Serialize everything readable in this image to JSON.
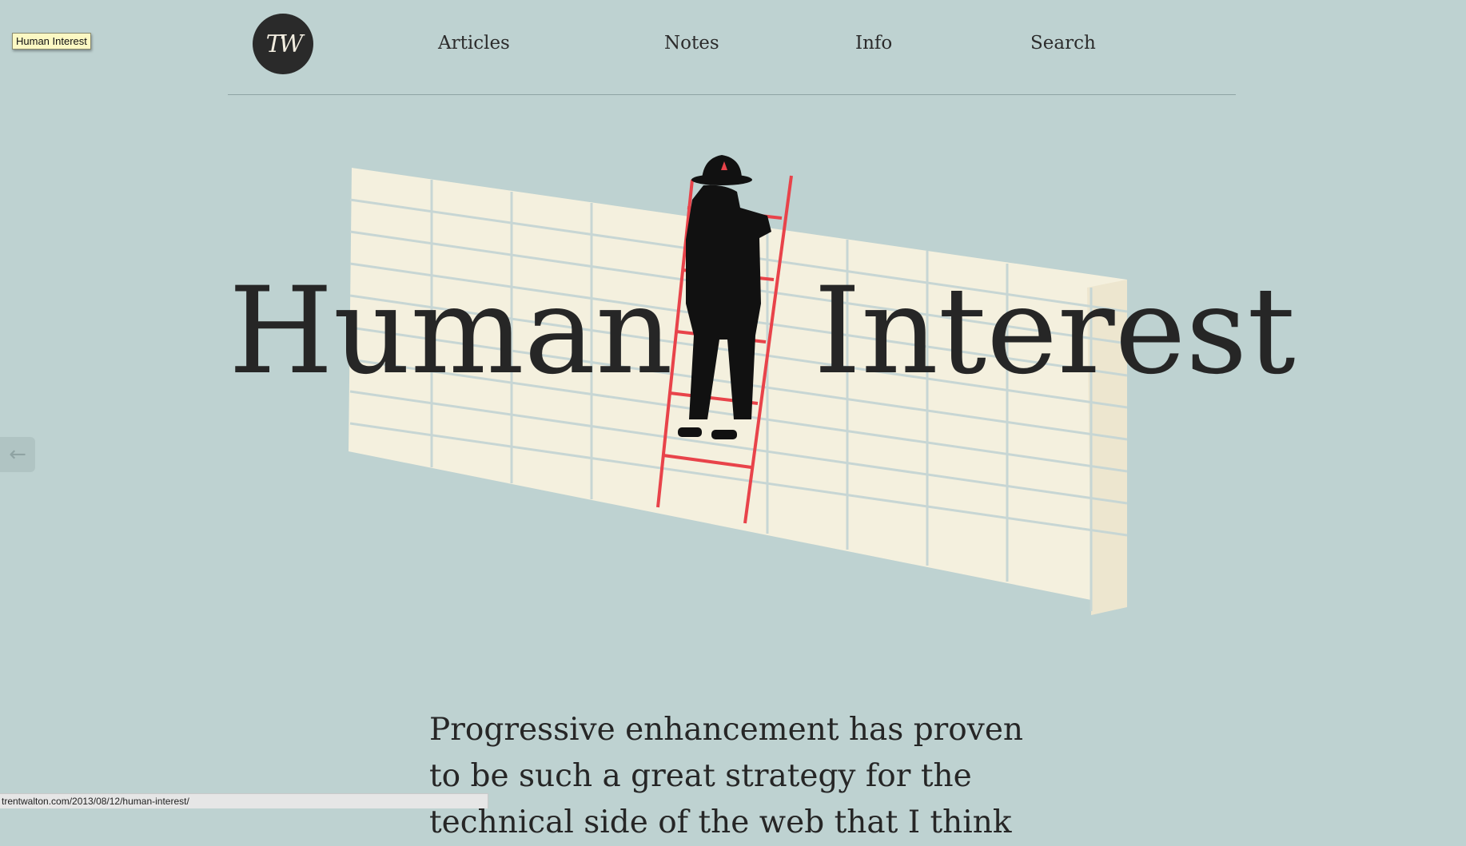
{
  "tooltip": {
    "text": "Human Interest"
  },
  "logo": {
    "monogram": "TW"
  },
  "nav": {
    "articles": "Articles",
    "notes": "Notes",
    "info": "Info",
    "search": "Search"
  },
  "hero": {
    "title_left": "Human",
    "title_right": "Interest",
    "illustration": "person-on-ladder-against-brick-wall"
  },
  "back_tab": {
    "icon": "arrow-left-icon",
    "glyph": "←"
  },
  "intro": {
    "text": "Progressive enhancement has proven to be such a great strategy for the technical side of the web that I think"
  },
  "status_bar": {
    "url": "trentwalton.com/2013/08/12/human-interest/"
  },
  "colors": {
    "background": "#bed2d1",
    "wall": "#f7f1de",
    "ladder": "#e8434a",
    "text": "#262626"
  }
}
